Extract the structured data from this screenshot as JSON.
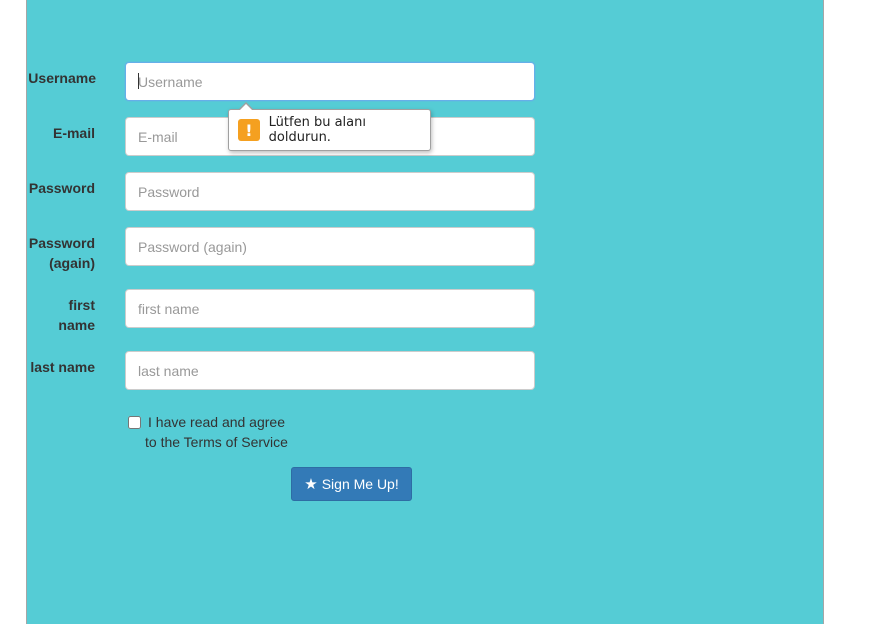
{
  "form": {
    "fields": [
      {
        "label": "Username",
        "placeholder": "Username",
        "value": ""
      },
      {
        "label": "E-mail",
        "placeholder": "E-mail",
        "value": ""
      },
      {
        "label": "Password",
        "placeholder": "Password",
        "value": ""
      },
      {
        "label_line1": "Password",
        "label_line2": "(again)",
        "placeholder": "Password (again)",
        "value": ""
      },
      {
        "label_line1": "first",
        "label_line2": "name",
        "placeholder": "first name",
        "value": ""
      },
      {
        "label": "last name",
        "placeholder": "last name",
        "value": ""
      }
    ],
    "agree_line1": "I have read and agree",
    "agree_line2": "to the Terms of Service",
    "agree_checked": false,
    "submit_label": "Sign Me Up!",
    "submit_icon": "star-icon"
  },
  "validation_tooltip": {
    "message": "Lütfen bu alanı doldurun.",
    "icon": "warning-icon",
    "icon_glyph": "!"
  },
  "colors": {
    "panel_background": "#55ccd5",
    "primary_button": "#337ab7",
    "warning_icon": "#f5a020"
  }
}
